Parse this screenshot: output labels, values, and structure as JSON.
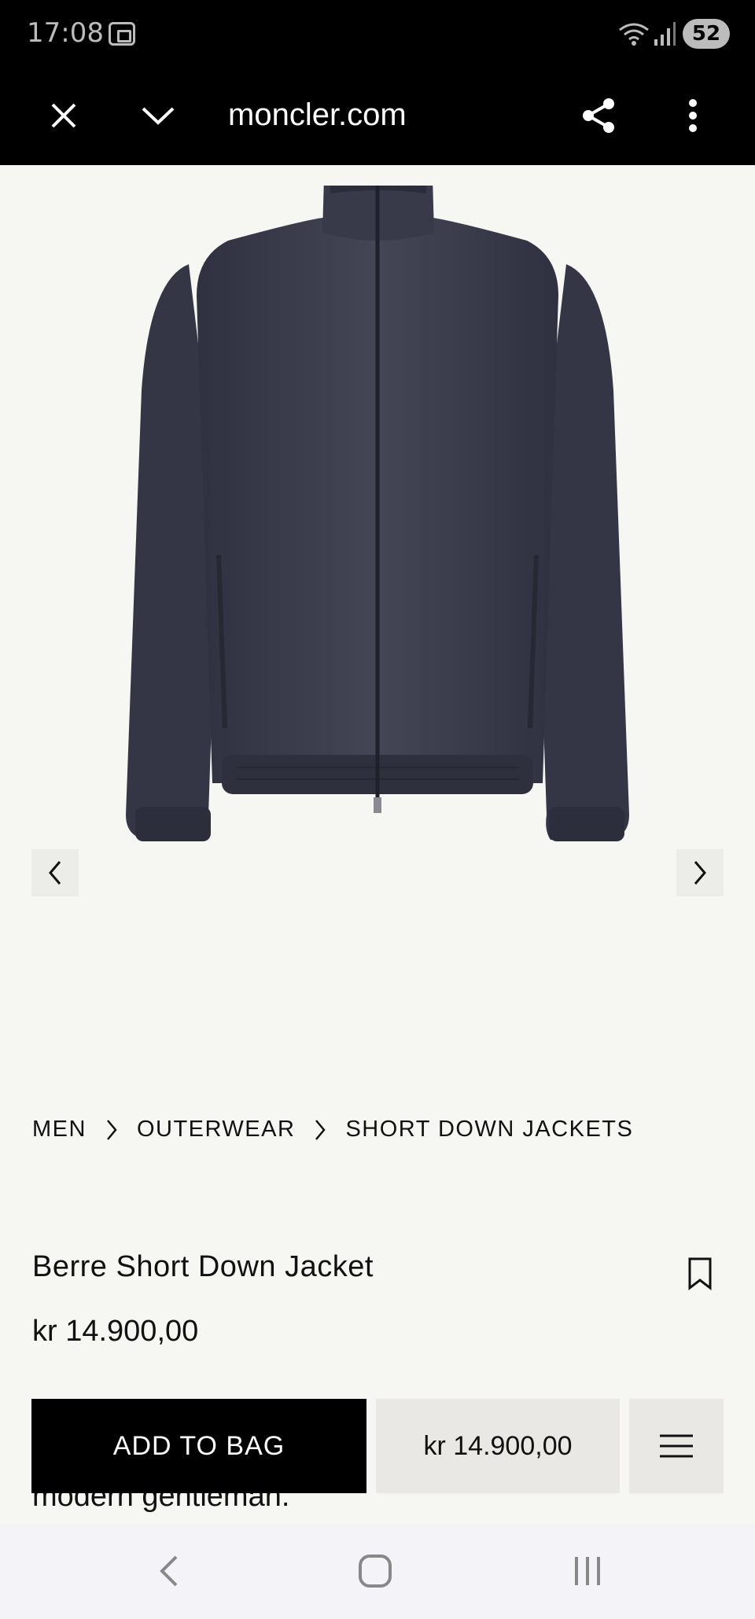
{
  "status_bar": {
    "time": "17:08",
    "battery": "52"
  },
  "browser": {
    "url": "moncler.com"
  },
  "breadcrumb": [
    "MEN",
    "OUTERWEAR",
    "SHORT DOWN JACKETS"
  ],
  "product": {
    "title": "Berre Short Down Jacket",
    "price": "kr 14.900,00",
    "description_peek": "modern gentleman."
  },
  "actions": {
    "add_to_bag": "ADD TO BAG",
    "sticky_price": "kr 14.900,00"
  },
  "icons": {
    "close": "close-icon",
    "collapse": "chevron-down-icon",
    "share": "share-icon",
    "more": "more-vert-icon",
    "prev": "chevron-left-icon",
    "next": "chevron-right-icon",
    "bookmark": "bookmark-icon",
    "menu": "hamburger-icon"
  },
  "colors": {
    "page_bg": "#f6f6f3",
    "jacket": "#3b3d4c",
    "button_bg": "#000000"
  }
}
